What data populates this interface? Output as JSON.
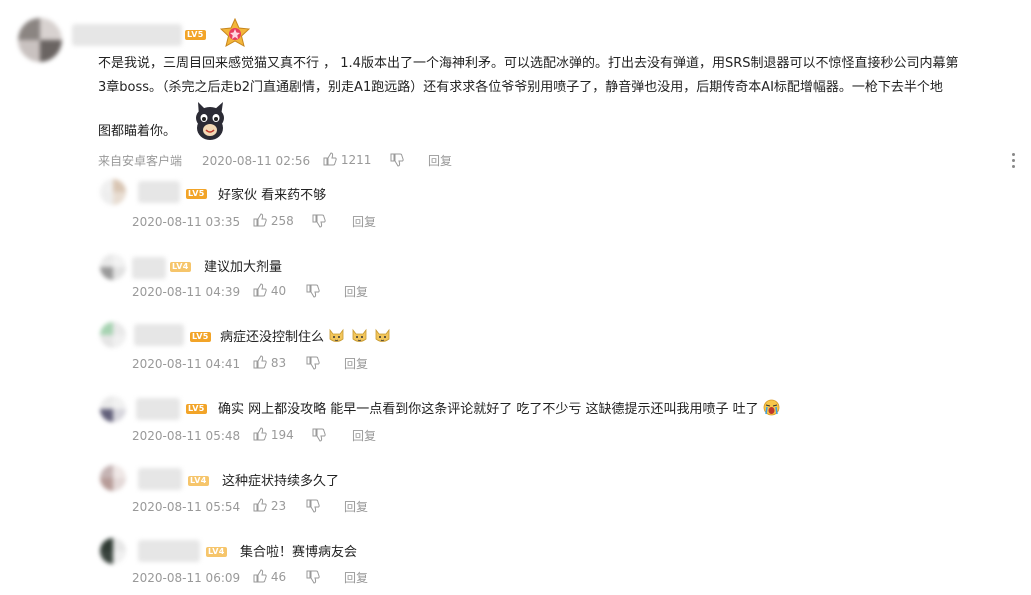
{
  "main_comment": {
    "level": "LV5",
    "text_lines": [
      "不是我说，三周目回来感觉猫又真不行 ， 1.4版本出了一个海神利矛。可以选配冰弹的。打出去没有弹道，用SRS制退器可以不惊怪直接秒公司内幕第",
      "3章boss。（杀完之后走b2门直通剧情，别走A1跑远路）还有求求各位爷爷别用喷子了，静音弹也没用，后期传奇本AI标配增幅器。一枪下去半个地",
      "图都瞄着你。"
    ],
    "source": "来自安卓客户端",
    "time": "2020-08-11 02:56",
    "likes": "1211",
    "reply_label": "回复"
  },
  "replies": [
    {
      "level": "LV5",
      "text": "好家伙 看来药不够",
      "time": "2020-08-11 03:35",
      "likes": "258",
      "reply_label": "回复"
    },
    {
      "level": "LV4",
      "text": "建议加大剂量",
      "time": "2020-08-11 04:39",
      "likes": "40",
      "reply_label": "回复"
    },
    {
      "level": "LV5",
      "text": "病症还没控制住么",
      "time": "2020-08-11 04:41",
      "likes": "83",
      "reply_label": "回复"
    },
    {
      "level": "LV5",
      "text": "确实 网上都没攻略 能早一点看到你这条评论就好了 吃了不少亏 这缺德提示还叫我用喷子 吐了",
      "time": "2020-08-11 05:48",
      "likes": "194",
      "reply_label": "回复"
    },
    {
      "level": "LV4",
      "text": "这种症状持续多久了",
      "time": "2020-08-11 05:54",
      "likes": "23",
      "reply_label": "回复"
    },
    {
      "level": "LV4",
      "text": "集合啦！赛博病友会",
      "time": "2020-08-11 06:09",
      "likes": "46",
      "reply_label": "回复"
    }
  ],
  "icons": {
    "like": "thumbs-up-icon",
    "dislike": "thumbs-down-icon",
    "more": "more-vertical-icon",
    "medal": "star-medal-icon"
  },
  "colors": {
    "level_badge": "#f2a428",
    "meta_text": "#999999"
  }
}
